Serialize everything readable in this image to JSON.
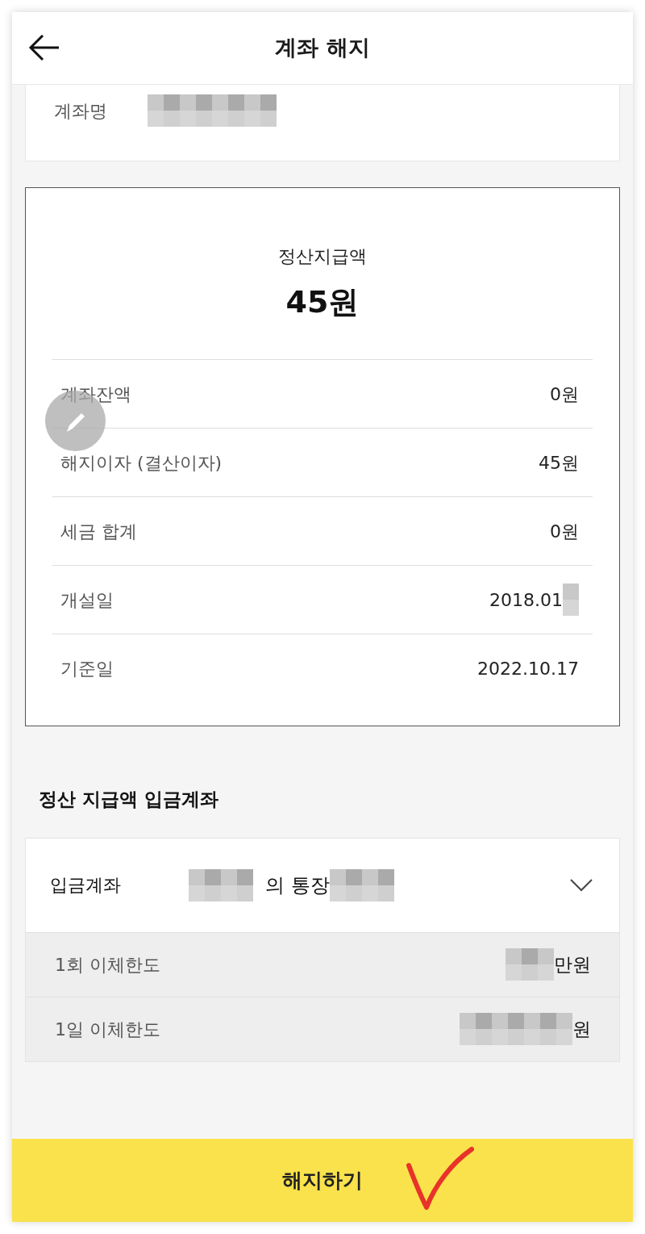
{
  "header": {
    "title": "계좌 해지"
  },
  "account_name": {
    "label": "계좌명",
    "value": [
      {
        "kind": "mask"
      }
    ]
  },
  "settlement": {
    "label": "정산지급액",
    "amount": "45원",
    "rows": [
      {
        "label": "계좌잔액",
        "value": [
          {
            "kind": "text",
            "text": "0원"
          }
        ]
      },
      {
        "label": "해지이자 (결산이자)",
        "value": [
          {
            "kind": "text",
            "text": "45원"
          }
        ]
      },
      {
        "label": "세금 합계",
        "value": [
          {
            "kind": "text",
            "text": "0원"
          }
        ]
      },
      {
        "label": "개설일",
        "value": [
          {
            "kind": "text",
            "text": "2018.01"
          },
          {
            "kind": "mask"
          }
        ]
      },
      {
        "label": "기준일",
        "value": [
          {
            "kind": "text",
            "text": "2022.10.17"
          }
        ]
      }
    ]
  },
  "deposit_section": {
    "title": "정산 지급액 입금계좌",
    "account": {
      "label": "입금계좌",
      "value": [
        {
          "kind": "mask"
        },
        {
          "kind": "text",
          "text": "의 통장"
        },
        {
          "kind": "mask"
        }
      ]
    },
    "limits": [
      {
        "label": "1회 이체한도",
        "value": [
          {
            "kind": "mask"
          },
          {
            "kind": "text",
            "text": "만원"
          }
        ]
      },
      {
        "label": "1일 이체한도",
        "value": [
          {
            "kind": "mask"
          },
          {
            "kind": "text",
            "text": "원"
          }
        ]
      }
    ]
  },
  "submit_button": {
    "label": "해지하기"
  }
}
